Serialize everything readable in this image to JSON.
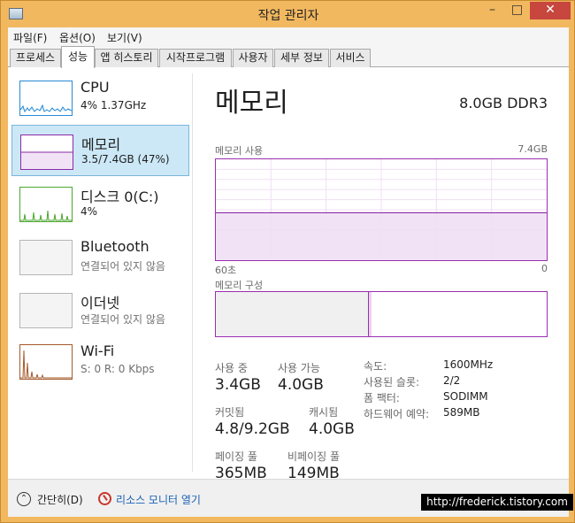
{
  "window": {
    "title": "작업 관리자",
    "controls": {
      "minimize": "–",
      "maximize": "□",
      "close": "✕"
    },
    "accent": "#f2b85f",
    "close_color": "#c7463d"
  },
  "menu": [
    "파일(F)",
    "옵션(O)",
    "보기(V)"
  ],
  "tabs": [
    "프로세스",
    "성능",
    "앱 히스토리",
    "시작프로그램",
    "사용자",
    "세부 정보",
    "서비스"
  ],
  "active_tab": "성능",
  "resources": [
    {
      "name": "CPU",
      "detail": "4% 1.37GHz",
      "color": "#2a8ad4",
      "icon": "cpu-graph-icon"
    },
    {
      "name": "메모리",
      "detail": "3.5/7.4GB (47%)",
      "color": "#8b2aa8",
      "icon": "memory-graph-icon",
      "selected": true
    },
    {
      "name": "디스크 0(C:)",
      "detail": "4%",
      "color": "#4da62f",
      "icon": "disk-graph-icon"
    },
    {
      "name": "Bluetooth",
      "detail": "연결되어 있지 않음",
      "color": "#999999",
      "icon": "bluetooth-graph-icon"
    },
    {
      "name": "이더넷",
      "detail": "연결되어 있지 않음",
      "color": "#999999",
      "icon": "ethernet-graph-icon"
    },
    {
      "name": "Wi-Fi",
      "detail": "S: 0 R: 0 Kbps",
      "color": "#a5592a",
      "icon": "wifi-graph-icon"
    }
  ],
  "memory": {
    "title": "메모리",
    "spec": "8.0GB DDR3",
    "usage_label": "메모리 사용",
    "usage_max": "7.4GB",
    "time_left": "60초",
    "time_right": "0",
    "used_fraction": 0.47,
    "composition_label": "메모리 구성",
    "stats": {
      "in_use_label": "사용 중",
      "in_use": "3.4GB",
      "available_label": "사용 가능",
      "available": "4.0GB",
      "committed_label": "커밋됨",
      "committed": "4.8/9.2GB",
      "cached_label": "캐시됨",
      "cached": "4.0GB",
      "paged_label": "페이징 풀",
      "paged": "365MB",
      "nonpaged_label": "비페이징 풀",
      "nonpaged": "149MB"
    },
    "specs": [
      {
        "key": "속도:",
        "value": "1600MHz"
      },
      {
        "key": "사용된 슬롯:",
        "value": "2/2"
      },
      {
        "key": "폼 팩터:",
        "value": "SODIMM"
      },
      {
        "key": "하드웨어 예약:",
        "value": "589MB"
      }
    ]
  },
  "footer": {
    "collapse": "간단히(D)",
    "resource_monitor": "리소스 모니터 열기"
  },
  "watermark": "http://frederick.tistory.com"
}
